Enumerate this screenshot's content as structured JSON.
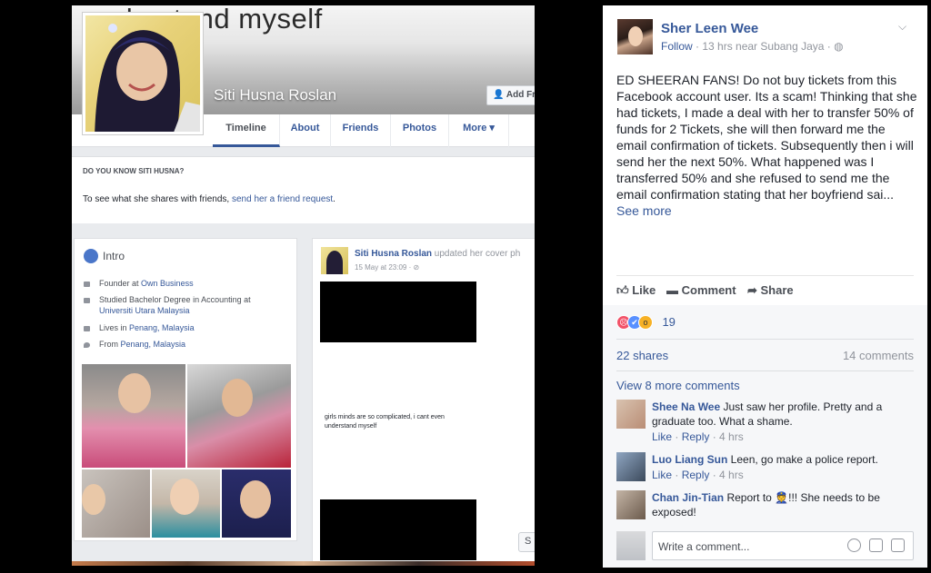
{
  "profile_page": {
    "cover_text": "understand myself",
    "profile_name": "Siti Husna Roslan",
    "add_friend_label": "Add Fr",
    "tabs": [
      "Timeline",
      "About",
      "Friends",
      "Photos",
      "More ▾"
    ],
    "know_heading": "DO YOU KNOW SITI HUSNA?",
    "know_text_prefix": "To see what she shares with friends,",
    "know_link": "send her a friend request",
    "know_suffix": ".",
    "intro": {
      "title": "Intro",
      "founder_prefix": "Founder at",
      "founder_link": "Own Business",
      "studied_prefix": "Studied Bachelor Degree in Accounting at",
      "studied_link": "Universiti Utara Malaysia",
      "lives_prefix": "Lives in",
      "lives_link": "Penang, Malaysia",
      "from_prefix": "From",
      "from_link": "Penang, Malaysia"
    },
    "post": {
      "author": "Siti Husna Roslan",
      "action": "updated her cover ph",
      "date": "15 May at 23:09 · ⊘",
      "preview_caption": "girls minds are so complicated, i cant even understand myself"
    }
  },
  "fb_post": {
    "author": "Sher Leen Wee",
    "follow_label": "Follow",
    "meta": " · 13 hrs near Subang Jaya · ◍",
    "body": "ED SHEERAN FANS! Do not buy tickets from this Facebook account user. Its a scam! Thinking that she had tickets, I made a deal with her to transfer 50% of funds for 2 Tickets, she will then forward me the email confirmation of tickets. Subsequently then i will send her the next 50%. What happened was I transferred 50% and she refused to send me the email confirmation stating that her boyfriend sai...",
    "see_more": "See more",
    "actions": {
      "like": "Like",
      "comment": "Comment",
      "share": "Share"
    },
    "reaction_count": "19",
    "shares": "22 shares",
    "comments_count": "14 comments",
    "view_more": "View 8 more comments",
    "comments": [
      {
        "name": "Shee Na Wee",
        "text": "Just saw her profile. Pretty and a graduate too. What a shame.",
        "like": "Like",
        "reply": "Reply",
        "time": "· 4 hrs"
      },
      {
        "name": "Luo Liang Sun",
        "text": "Leen, go make a police report.",
        "like": "Like",
        "reply": "Reply",
        "time": "· 4 hrs"
      },
      {
        "name": "Chan Jin-Tian",
        "text_prefix": "Report to",
        "text_suffix": "!!! She needs to be exposed!"
      }
    ],
    "write_placeholder": "Write a comment...",
    "colors": {
      "link": "#365899",
      "muted": "#90949c",
      "angry": "#f25268",
      "like": "#5890ff",
      "wow": "#f7b125"
    }
  }
}
